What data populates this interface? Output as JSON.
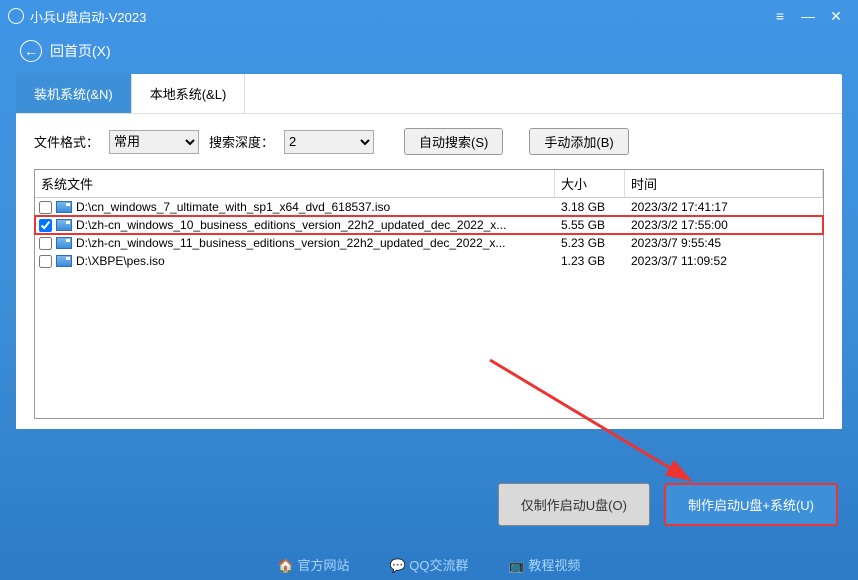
{
  "title": "小兵U盘启动-V2023",
  "back_label": "回首页(X)",
  "tabs": {
    "install": "装机系统(&N)",
    "local": "本地系统(&L)"
  },
  "controls": {
    "file_format_label": "文件格式：",
    "file_format_value": "常用",
    "depth_label": "搜索深度：",
    "depth_value": "2",
    "auto_search": "自动搜索(S)",
    "manual_add": "手动添加(B)"
  },
  "headers": {
    "name": "系统文件",
    "size": "大小",
    "time": "时间"
  },
  "rows": [
    {
      "checked": false,
      "path": "D:\\cn_windows_7_ultimate_with_sp1_x64_dvd_618537.iso",
      "size": "3.18 GB",
      "time": "2023/3/2 17:41:17",
      "hl": false
    },
    {
      "checked": true,
      "path": "D:\\zh-cn_windows_10_business_editions_version_22h2_updated_dec_2022_x...",
      "size": "5.55 GB",
      "time": "2023/3/2 17:55:00",
      "hl": true
    },
    {
      "checked": false,
      "path": "D:\\zh-cn_windows_11_business_editions_version_22h2_updated_dec_2022_x...",
      "size": "5.23 GB",
      "time": "2023/3/7 9:55:45",
      "hl": false
    },
    {
      "checked": false,
      "path": "D:\\XBPE\\pes.iso",
      "size": "1.23 GB",
      "time": "2023/3/7 11:09:52",
      "hl": false
    }
  ],
  "buttons": {
    "only_usb": "仅制作启动U盘(O)",
    "usb_sys": "制作启动U盘+系统(U)"
  },
  "footer": {
    "site": "官方网站",
    "qq": "QQ交流群",
    "video": "教程视频"
  }
}
